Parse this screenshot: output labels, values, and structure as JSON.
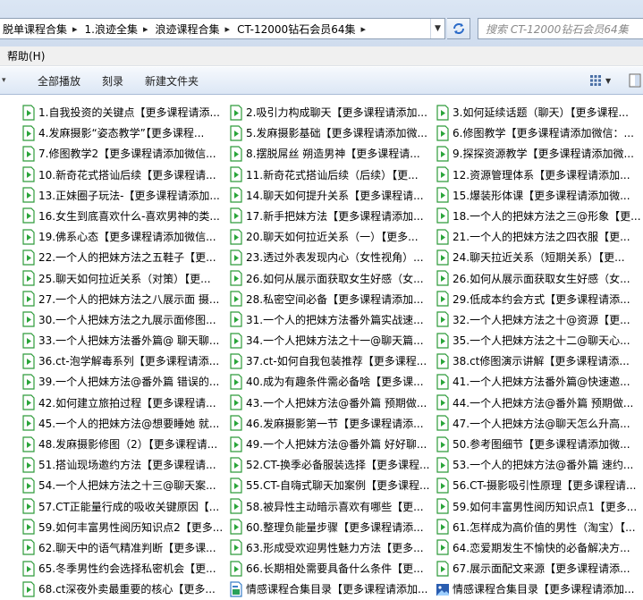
{
  "breadcrumb": [
    "脱单课程合集",
    "1.浪迹全集",
    "浪迹课程合集",
    "CT-12000钻石会员64集"
  ],
  "search": {
    "placeholder": "搜索 CT-12000钻石会员64集"
  },
  "menu": {
    "help": "帮助(H)"
  },
  "toolbar": {
    "play_all": "全部播放",
    "burn": "刻录",
    "new_folder": "新建文件夹"
  },
  "files": [
    {
      "name": "1.自我投资的关键点【更多课程请添...",
      "icon": "video-file-icon"
    },
    {
      "name": "2.吸引力构成聊天【更多课程请添加...",
      "icon": "video-file-icon"
    },
    {
      "name": "3.如何延续话题（聊天）【更多课程...",
      "icon": "video-file-icon"
    },
    {
      "name": "4.发麻摄影“姿态教学”【更多课程...",
      "icon": "video-file-icon"
    },
    {
      "name": "5.发麻摄影基础【更多课程请添加微...",
      "icon": "video-file-icon"
    },
    {
      "name": "6.修图教学【更多课程请添加微信：...",
      "icon": "video-file-icon"
    },
    {
      "name": "7.修图教学2【更多课程请添加微信...",
      "icon": "video-file-icon"
    },
    {
      "name": "8.摆脱屌丝 朔造男神【更多课程请...",
      "icon": "video-file-icon"
    },
    {
      "name": "9.探探资源教学【更多课程请添加微...",
      "icon": "video-file-icon"
    },
    {
      "name": "10.新奇花式搭讪后续【更多课程请...",
      "icon": "video-file-icon"
    },
    {
      "name": "11.新奇花式搭讪后续（后续）【更...",
      "icon": "video-file-icon"
    },
    {
      "name": "12.资源管理体系【更多课程请添加...",
      "icon": "video-file-icon"
    },
    {
      "name": "13.正妹圈子玩法-【更多课程请添加...",
      "icon": "video-file-icon"
    },
    {
      "name": "14.聊天如何提升关系【更多课程请...",
      "icon": "video-file-icon"
    },
    {
      "name": "15.爆装形体课【更多课程请添加微...",
      "icon": "video-file-icon"
    },
    {
      "name": "16.女生到底喜欢什么-喜欢男神的类...",
      "icon": "video-file-icon"
    },
    {
      "name": "17.新手把妹方法【更多课程请添加...",
      "icon": "video-file-icon"
    },
    {
      "name": "18.一个人的把妹方法之三@形象【更...",
      "icon": "video-file-icon"
    },
    {
      "name": "19.佛系心态【更多课程请添加微信...",
      "icon": "video-file-icon"
    },
    {
      "name": "20.聊天如何拉近关系（一）【更多...",
      "icon": "video-file-icon"
    },
    {
      "name": "21.一个人的把妹方法之四衣服【更...",
      "icon": "video-file-icon"
    },
    {
      "name": "22.一个人的把妹方法之五鞋子【更...",
      "icon": "video-file-icon"
    },
    {
      "name": "23.透过外表发现内心（女性视角）...",
      "icon": "video-file-icon"
    },
    {
      "name": "24.聊天拉近关系（短期关系）【更...",
      "icon": "video-file-icon"
    },
    {
      "name": "25.聊天如何拉近关系（对策）【更...",
      "icon": "video-file-icon"
    },
    {
      "name": "26.如何从展示面获取女生好感（女...",
      "icon": "video-file-icon"
    },
    {
      "name": "26.如何从展示面获取女生好感（女...",
      "icon": "video-file-icon"
    },
    {
      "name": "27.一个人的把妹方法之八展示面 摄...",
      "icon": "video-file-icon"
    },
    {
      "name": "28.私密空间必备【更多课程请添加...",
      "icon": "video-file-icon"
    },
    {
      "name": "29.低成本约会方式【更多课程请添...",
      "icon": "video-file-icon"
    },
    {
      "name": "30.一个人把妹方法之九展示面修图...",
      "icon": "video-file-icon"
    },
    {
      "name": "31.一个人的把妹方法番外篇实战速...",
      "icon": "video-file-icon"
    },
    {
      "name": "32.一个人把妹方法之十@资源【更...",
      "icon": "video-file-icon"
    },
    {
      "name": "33.一个人把妹方法番外篇@ 聊天聊...",
      "icon": "video-file-icon"
    },
    {
      "name": "34.一个人把妹方法之十一@聊天篇...",
      "icon": "video-file-icon"
    },
    {
      "name": "35.一个人把妹方法之十二@聊天心...",
      "icon": "video-file-icon"
    },
    {
      "name": "36.ct-泡学解毒系列【更多课程请添...",
      "icon": "video-file-icon"
    },
    {
      "name": "37.ct-如何自我包装推荐【更多课程...",
      "icon": "video-file-icon"
    },
    {
      "name": "38.ct修图演示讲解【更多课程请添...",
      "icon": "video-file-icon"
    },
    {
      "name": "39.一个人把妹方法@番外篇 错误的...",
      "icon": "video-file-icon"
    },
    {
      "name": "40.成为有趣条件需必备啥【更多课...",
      "icon": "video-file-icon"
    },
    {
      "name": "41.一个人把妹方法番外篇@快速邀...",
      "icon": "video-file-icon"
    },
    {
      "name": "42.如何建立旅拍过程【更多课程请...",
      "icon": "video-file-icon"
    },
    {
      "name": "43.一个人把妹方法@番外篇 预期做...",
      "icon": "video-file-icon"
    },
    {
      "name": "44.一个人把妹方法@番外篇 预期做...",
      "icon": "video-file-icon"
    },
    {
      "name": "45.一个人的把妹方法@想要睡她 就...",
      "icon": "video-file-icon"
    },
    {
      "name": "46.发麻摄影第一节【更多课程请添...",
      "icon": "video-file-icon"
    },
    {
      "name": "47.一个人把妹方法@聊天怎么升高...",
      "icon": "video-file-icon"
    },
    {
      "name": "48.发麻摄影修图（2）【更多课程请...",
      "icon": "video-file-icon"
    },
    {
      "name": "49.一个人把妹方法@番外篇 好好聊...",
      "icon": "video-file-icon"
    },
    {
      "name": "50.参考图细节【更多课程请添加微...",
      "icon": "video-file-icon"
    },
    {
      "name": "51.搭讪现场邀约方法【更多课程请...",
      "icon": "video-file-icon"
    },
    {
      "name": "52.CT-换季必备服装选择【更多课程...",
      "icon": "video-file-icon"
    },
    {
      "name": "53.一个人的把妹方法@番外篇 速约...",
      "icon": "video-file-icon"
    },
    {
      "name": "54.一个人把妹方法之十三@聊天案...",
      "icon": "video-file-icon"
    },
    {
      "name": "55.CT-自嗨式聊天加案例【更多课程...",
      "icon": "video-file-icon"
    },
    {
      "name": "56.CT-摄影吸引性原理【更多课程请...",
      "icon": "video-file-icon"
    },
    {
      "name": "57.CT正能量行成的吸收关键原因【...",
      "icon": "video-file-icon"
    },
    {
      "name": "58.被异性主动暗示喜欢有哪些【更...",
      "icon": "video-file-icon"
    },
    {
      "name": "59.如何丰富男性阅历知识点1【更多...",
      "icon": "video-file-icon"
    },
    {
      "name": "59.如何丰富男性阅历知识点2【更多...",
      "icon": "video-file-icon"
    },
    {
      "name": "60.整理负能量步骤【更多课程请添...",
      "icon": "video-file-icon"
    },
    {
      "name": "61.怎样成为高价值的男性（淘宝）【...",
      "icon": "video-file-icon"
    },
    {
      "name": "62.聊天中的语气精准判断【更多课...",
      "icon": "video-file-icon"
    },
    {
      "name": "63.形成受欢迎男性魅力方法【更多...",
      "icon": "video-file-icon"
    },
    {
      "name": "64.恋爱期发生不愉快的必备解决方...",
      "icon": "video-file-icon"
    },
    {
      "name": "65.冬季男性约会选择私密机会【更...",
      "icon": "video-file-icon"
    },
    {
      "name": "66.长期相处需要具备什么条件【更...",
      "icon": "video-file-icon"
    },
    {
      "name": "67.展示面配文来源【更多课程请添...",
      "icon": "video-file-icon"
    },
    {
      "name": "68.ct深夜外卖最重要的核心【更多...",
      "icon": "video-file-icon"
    },
    {
      "name": "情感课程合集目录【更多课程请添加...",
      "icon": "document-file-icon"
    },
    {
      "name": "情感课程合集目录【更多课程请添加...",
      "icon": "image-file-icon"
    }
  ],
  "colors": {
    "video_icon": "#2aa53a",
    "breadcrumb_bg": "#d6e2f1",
    "toolbar_bg": "#e6eef8"
  }
}
